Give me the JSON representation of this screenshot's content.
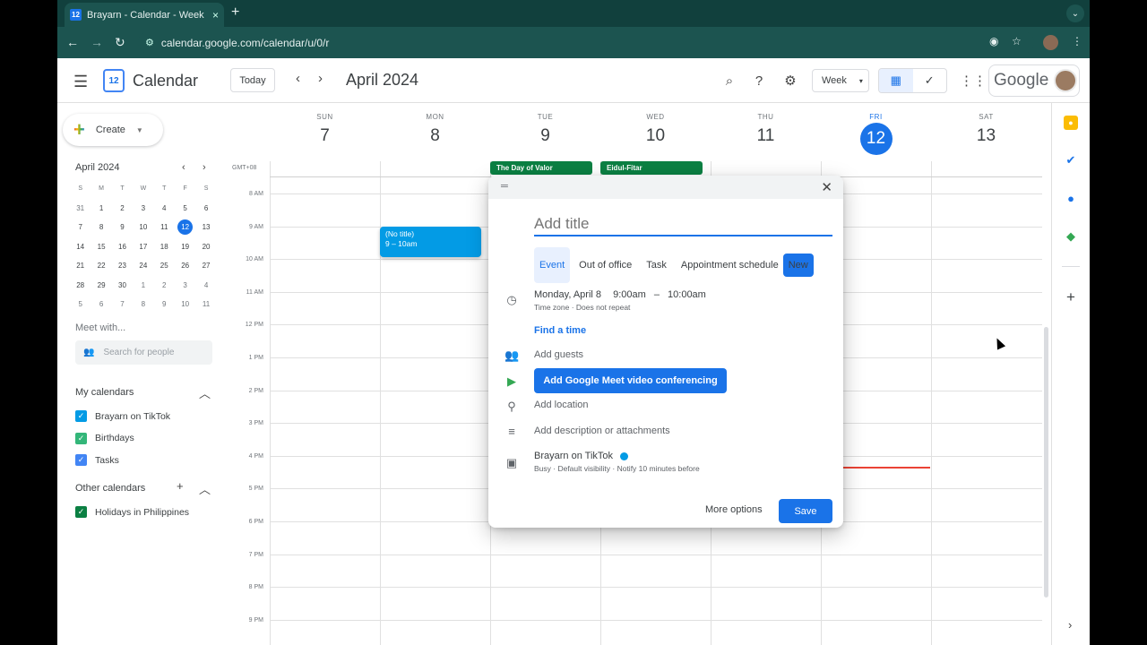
{
  "browser": {
    "tab_title": "Brayarn - Calendar - Week of",
    "tab_close": "×",
    "new_tab": "+",
    "favicon_text": "12",
    "url": "calendar.google.com/calendar/u/0/r"
  },
  "header": {
    "app_name": "Calendar",
    "logo_text": "12",
    "today_label": "Today",
    "month_title": "April 2024",
    "view_select": "Week",
    "google_label": "Google"
  },
  "sidebar": {
    "create_label": "Create",
    "mini_calendar": {
      "title": "April 2024",
      "weekdays": [
        "S",
        "M",
        "T",
        "W",
        "T",
        "F",
        "S"
      ],
      "weeks": [
        [
          "31",
          "1",
          "2",
          "3",
          "4",
          "5",
          "6"
        ],
        [
          "7",
          "8",
          "9",
          "10",
          "11",
          "12",
          "13"
        ],
        [
          "14",
          "15",
          "16",
          "17",
          "18",
          "19",
          "20"
        ],
        [
          "21",
          "22",
          "23",
          "24",
          "25",
          "26",
          "27"
        ],
        [
          "28",
          "29",
          "30",
          "1",
          "2",
          "3",
          "4"
        ],
        [
          "5",
          "6",
          "7",
          "8",
          "9",
          "10",
          "11"
        ]
      ],
      "today": "12"
    },
    "meet_with": "Meet with...",
    "search_people_placeholder": "Search for people",
    "my_calendars_title": "My calendars",
    "my_calendars": [
      {
        "name": "Brayarn on TikTok",
        "color": "#039be5"
      },
      {
        "name": "Birthdays",
        "color": "#33b679"
      },
      {
        "name": "Tasks",
        "color": "#4285f4"
      }
    ],
    "other_calendars_title": "Other calendars",
    "other_calendars": [
      {
        "name": "Holidays in Philippines",
        "color": "#0b8043"
      }
    ]
  },
  "week": {
    "days": [
      {
        "dow": "SUN",
        "num": "7"
      },
      {
        "dow": "MON",
        "num": "8"
      },
      {
        "dow": "TUE",
        "num": "9"
      },
      {
        "dow": "WED",
        "num": "10"
      },
      {
        "dow": "THU",
        "num": "11"
      },
      {
        "dow": "FRI",
        "num": "12"
      },
      {
        "dow": "SAT",
        "num": "13"
      }
    ],
    "timezone": "GMT+08",
    "hours": [
      "8 AM",
      "9 AM",
      "10 AM",
      "11 AM",
      "12 PM",
      "1 PM",
      "2 PM",
      "3 PM",
      "4 PM",
      "5 PM",
      "6 PM",
      "7 PM",
      "8 PM",
      "9 PM"
    ],
    "allday_events": [
      {
        "title": "The Day of Valor"
      },
      {
        "title": "Eidul-Fitar"
      }
    ],
    "draft_event": {
      "title": "(No title)",
      "time": "9 – 10am"
    }
  },
  "dialog": {
    "title_placeholder": "Add title",
    "tabs": [
      "Event",
      "Out of office",
      "Task",
      "Appointment schedule"
    ],
    "new_badge": "New",
    "date": "Monday, April 8",
    "start": "9:00am",
    "dash": "–",
    "end": "10:00am",
    "time_sub": "Time zone · Does not repeat",
    "find_time": "Find a time",
    "add_guests": "Add guests",
    "meet_button": "Add Google Meet video conferencing",
    "add_location": "Add location",
    "add_description": "Add description or attachments",
    "calendar_owner": "Brayarn on TikTok",
    "owner_sub": "Busy · Default visibility · Notify 10 minutes before",
    "more_options": "More options",
    "save": "Save"
  }
}
